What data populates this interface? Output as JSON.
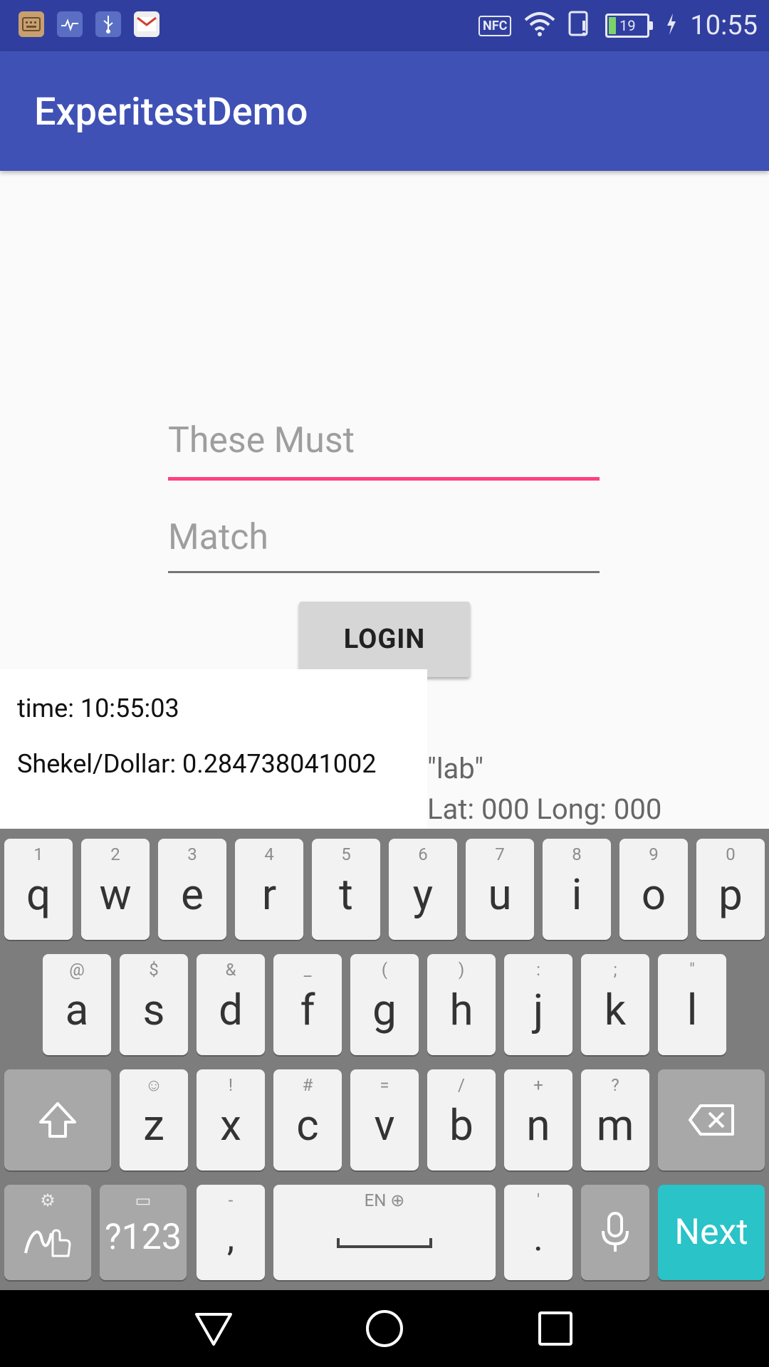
{
  "status_bar": {
    "time": "10:55",
    "battery": "19",
    "nfc": "NFC",
    "left_icons": [
      "keyboard-icon",
      "health-icon",
      "usb-icon",
      "gmail-icon"
    ]
  },
  "app_bar": {
    "title": "ExperitestDemo"
  },
  "form": {
    "field1_text": "These Must",
    "field2_placeholder": "Match",
    "login_label": "LOGIN"
  },
  "info": {
    "time_text": "time: 10:55:03",
    "rate_text": "Shekel/Dollar: 0.284738041002",
    "location_name": "\"lab\"",
    "coords_text": "Lat: 000  Long: 000"
  },
  "keyboard": {
    "row1": [
      {
        "k": "q",
        "h": "1"
      },
      {
        "k": "w",
        "h": "2"
      },
      {
        "k": "e",
        "h": "3"
      },
      {
        "k": "r",
        "h": "4"
      },
      {
        "k": "t",
        "h": "5"
      },
      {
        "k": "y",
        "h": "6"
      },
      {
        "k": "u",
        "h": "7"
      },
      {
        "k": "i",
        "h": "8"
      },
      {
        "k": "o",
        "h": "9"
      },
      {
        "k": "p",
        "h": "0"
      }
    ],
    "row2": [
      {
        "k": "a",
        "h": "@"
      },
      {
        "k": "s",
        "h": "$"
      },
      {
        "k": "d",
        "h": "&"
      },
      {
        "k": "f",
        "h": "_"
      },
      {
        "k": "g",
        "h": "("
      },
      {
        "k": "h",
        "h": ")"
      },
      {
        "k": "j",
        "h": ":"
      },
      {
        "k": "k",
        "h": ";"
      },
      {
        "k": "l",
        "h": "\""
      }
    ],
    "row3": [
      {
        "k": "z",
        "h": "☺"
      },
      {
        "k": "x",
        "h": "!"
      },
      {
        "k": "c",
        "h": "#"
      },
      {
        "k": "v",
        "h": "="
      },
      {
        "k": "b",
        "h": "/"
      },
      {
        "k": "n",
        "h": "+"
      },
      {
        "k": "m",
        "h": "?"
      }
    ],
    "symbols_label": "?123",
    "comma": ",",
    "comma_hint": "-",
    "space_hint": "EN ⊕",
    "period": ".",
    "period_hint": "'",
    "next_label": "Next",
    "accent_color": "#29c3c8"
  },
  "colors": {
    "primary": "#3f51b5",
    "primary_dark": "#303f9f",
    "accent": "#ff4081"
  }
}
